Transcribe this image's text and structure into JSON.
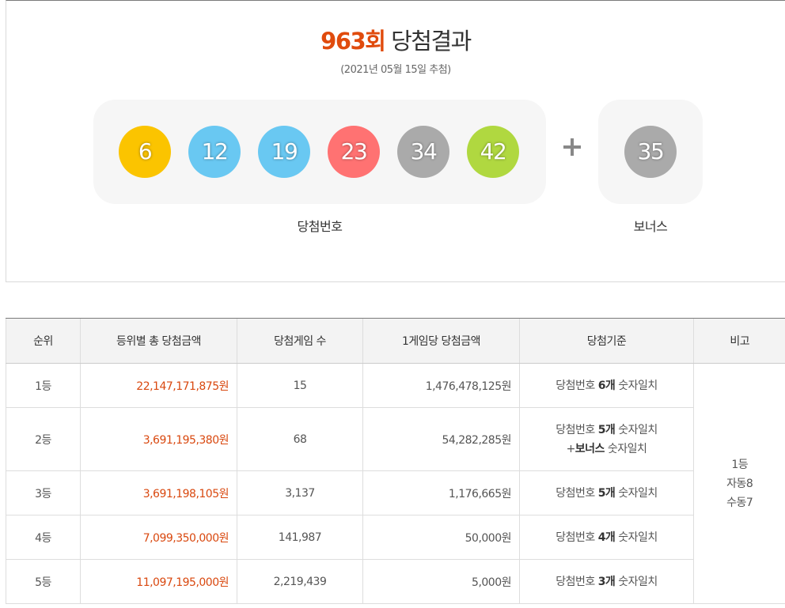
{
  "result": {
    "round": "963회",
    "title_suffix": " 당첨결과",
    "date": "(2021년 05월 15일 추첨)",
    "numbers": [
      {
        "value": "6",
        "color": "#fbc400"
      },
      {
        "value": "12",
        "color": "#69c8f2"
      },
      {
        "value": "19",
        "color": "#69c8f2"
      },
      {
        "value": "23",
        "color": "#ff7272"
      },
      {
        "value": "34",
        "color": "#aaaaaa"
      },
      {
        "value": "42",
        "color": "#b0d840"
      }
    ],
    "bonus": {
      "value": "35",
      "color": "#aaaaaa"
    },
    "numbers_label": "당첨번호",
    "bonus_label": "보너스"
  },
  "table": {
    "headers": [
      "순위",
      "등위별 총 당첨금액",
      "당첨게임 수",
      "1게임당 당첨금액",
      "당첨기준",
      "비고"
    ],
    "rows": [
      {
        "rank": "1등",
        "total": "22,147,171,875원",
        "games": "15",
        "per_game": "1,476,478,125원",
        "crit_pre": "당첨번호 ",
        "crit_bold": "6개",
        "crit_post": " 숫자일치"
      },
      {
        "rank": "2등",
        "total": "3,691,195,380원",
        "games": "68",
        "per_game": "54,282,285원",
        "crit_pre": "당첨번호 ",
        "crit_bold": "5개",
        "crit_post": " 숫자일치",
        "crit2_pre": "+",
        "crit2_bold": "보너스",
        "crit2_post": " 숫자일치"
      },
      {
        "rank": "3등",
        "total": "3,691,198,105원",
        "games": "3,137",
        "per_game": "1,176,665원",
        "crit_pre": "당첨번호 ",
        "crit_bold": "5개",
        "crit_post": " 숫자일치"
      },
      {
        "rank": "4등",
        "total": "7,099,350,000원",
        "games": "141,987",
        "per_game": "50,000원",
        "crit_pre": "당첨번호 ",
        "crit_bold": "4개",
        "crit_post": " 숫자일치"
      },
      {
        "rank": "5등",
        "total": "11,097,195,000원",
        "games": "2,219,439",
        "per_game": "5,000원",
        "crit_pre": "당첨번호 ",
        "crit_bold": "3개",
        "crit_post": " 숫자일치"
      }
    ],
    "note": {
      "line1": "1등",
      "line2": "자동8",
      "line3": "수동7"
    }
  }
}
